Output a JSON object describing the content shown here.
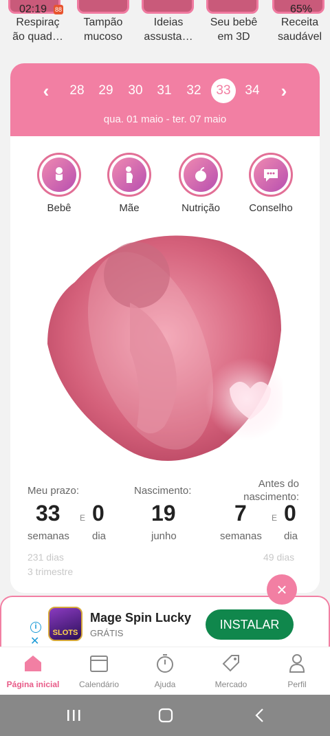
{
  "status_bar": {
    "time": "02:19",
    "notif_badge": "88",
    "right_text": "65%"
  },
  "stories": [
    {
      "label": "Respiraç\não quad…"
    },
    {
      "label": "Tampão\nmucoso"
    },
    {
      "label": "Ideias\nassusta…"
    },
    {
      "label": "Seu bebê\nem 3D"
    },
    {
      "label": "Receita\nsaudável"
    }
  ],
  "weeks": [
    "28",
    "29",
    "30",
    "31",
    "32",
    "33",
    "34"
  ],
  "active_week": "33",
  "date_range": "qua. 01 maio - ter. 07 maio",
  "categories": [
    {
      "label": "Bebê",
      "icon": "baby-icon"
    },
    {
      "label": "Mãe",
      "icon": "mother-icon"
    },
    {
      "label": "Nutrição",
      "icon": "apple-icon"
    },
    {
      "label": "Conselho",
      "icon": "chat-icon"
    }
  ],
  "stats": {
    "term": {
      "label": "Meu prazo:",
      "weeks": "33",
      "and": "E",
      "days": "0",
      "weeks_unit": "semanas",
      "days_unit": "dia",
      "total_days": "231 dias",
      "trimester": "3 trimestre"
    },
    "birth": {
      "label": "Nascimento:",
      "day": "19",
      "month": "junho"
    },
    "before": {
      "label": "Antes do\nnascimento:",
      "weeks": "7",
      "and": "E",
      "days": "0",
      "weeks_unit": "semanas",
      "days_unit": "dia",
      "total_days": "49 dias"
    }
  },
  "ad": {
    "title": "Mage Spin Lucky",
    "subtitle": "GRÁTIS",
    "cta": "INSTALAR",
    "icon_text": "SLOTS"
  },
  "nav": [
    {
      "label": "Página inicial",
      "icon": "home-icon",
      "active": true
    },
    {
      "label": "Calendário",
      "icon": "calendar-icon",
      "active": false
    },
    {
      "label": "Ajuda",
      "icon": "timer-icon",
      "active": false
    },
    {
      "label": "Mercado",
      "icon": "tag-icon",
      "active": false
    },
    {
      "label": "Perfil",
      "icon": "person-icon",
      "active": false
    }
  ],
  "colors": {
    "accent": "#f27fa3",
    "install": "#10874c"
  }
}
